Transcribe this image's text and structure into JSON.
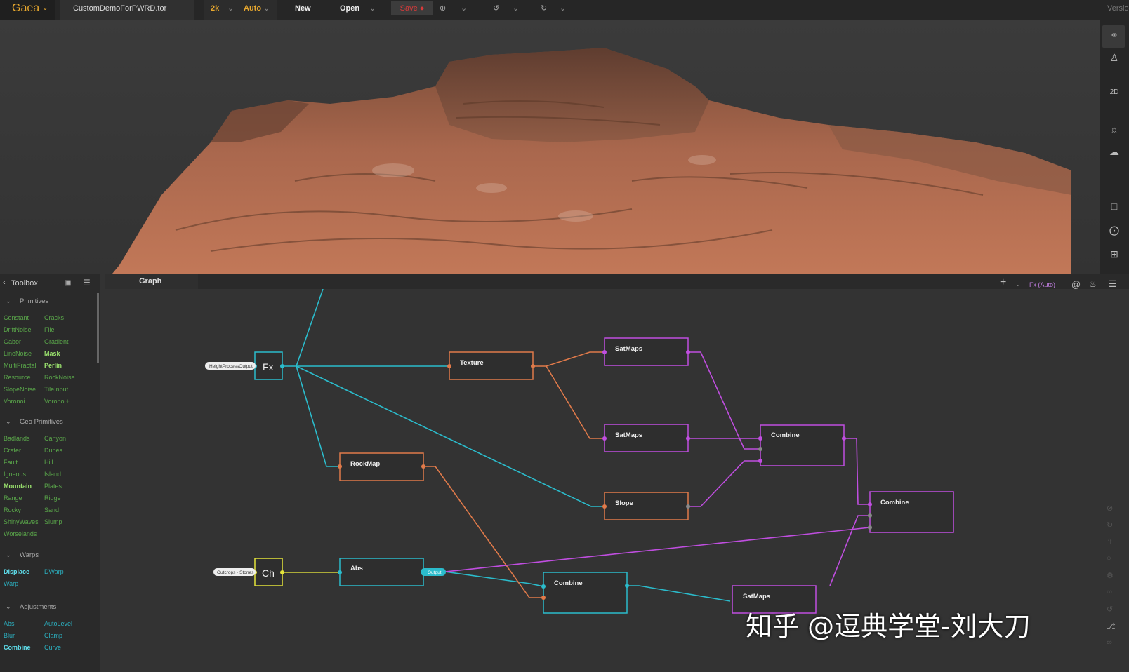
{
  "topbar": {
    "app_title": "Gaea",
    "file_name": "CustomDemoForPWRD.tor",
    "resolution": "2k",
    "mode": "Auto",
    "new_label": "New",
    "open_label": "Open",
    "save_label": "Save ●",
    "version_label": "Versio"
  },
  "viewport": {
    "toolbar_labels": {
      "view_2d": "2D"
    }
  },
  "toolbox": {
    "title": "Toolbox",
    "categories": [
      {
        "name": "Primitives",
        "items": [
          [
            "Constant",
            "Cracks"
          ],
          [
            "DriftNoise",
            "File"
          ],
          [
            "Gabor",
            "Gradient"
          ],
          [
            "LineNoise",
            "Mask"
          ],
          [
            "MultiFractal",
            "Perlin"
          ],
          [
            "Resource",
            "RockNoise"
          ],
          [
            "SlopeNoise",
            "TileInput"
          ],
          [
            "Voronoi",
            "Voronoi+"
          ]
        ]
      },
      {
        "name": "Geo Primitives",
        "items": [
          [
            "Badlands",
            "Canyon"
          ],
          [
            "Crater",
            "Dunes"
          ],
          [
            "Fault",
            "Hill"
          ],
          [
            "Igneous",
            "Island"
          ],
          [
            "Mountain",
            "Plates"
          ],
          [
            "Range",
            "Ridge"
          ],
          [
            "Rocky",
            "Sand"
          ],
          [
            "ShinyWaves",
            "Slump"
          ],
          [
            "Worselands",
            ""
          ]
        ]
      },
      {
        "name": "Warps",
        "items": [
          [
            "Displace",
            "DWarp"
          ],
          [
            "Warp",
            ""
          ]
        ]
      },
      {
        "name": "Adjustments",
        "items": [
          [
            "Abs",
            "AutoLevel"
          ],
          [
            "Blur",
            "Clamp"
          ],
          [
            "Combine",
            "Curve"
          ]
        ]
      }
    ]
  },
  "graph": {
    "tab_title": "Graph",
    "fx_label": "Fx (Auto)",
    "nodes": {
      "fx": "Fx",
      "ch": "Ch",
      "texture": "Texture",
      "satmaps1": "SatMaps",
      "satmaps2": "SatMaps",
      "satmaps3": "SatMaps",
      "rockmap": "RockMap",
      "slope": "Slope",
      "combine1": "Combine",
      "combine2": "Combine",
      "combine3": "Combine",
      "abs": "Abs"
    },
    "pills": {
      "height_output": "HeightProcessOutput",
      "outcrops": "Outcrops · Stones",
      "output": "Output"
    }
  },
  "watermark": "知乎 @逗典学堂-刘大刀",
  "colors": {
    "accent": "#e8a82e",
    "cyan": "#2bbccc",
    "orange": "#e07a4a",
    "purple": "#c04ee0",
    "yellow": "#e4e43a",
    "save_red": "#d93a3a"
  }
}
